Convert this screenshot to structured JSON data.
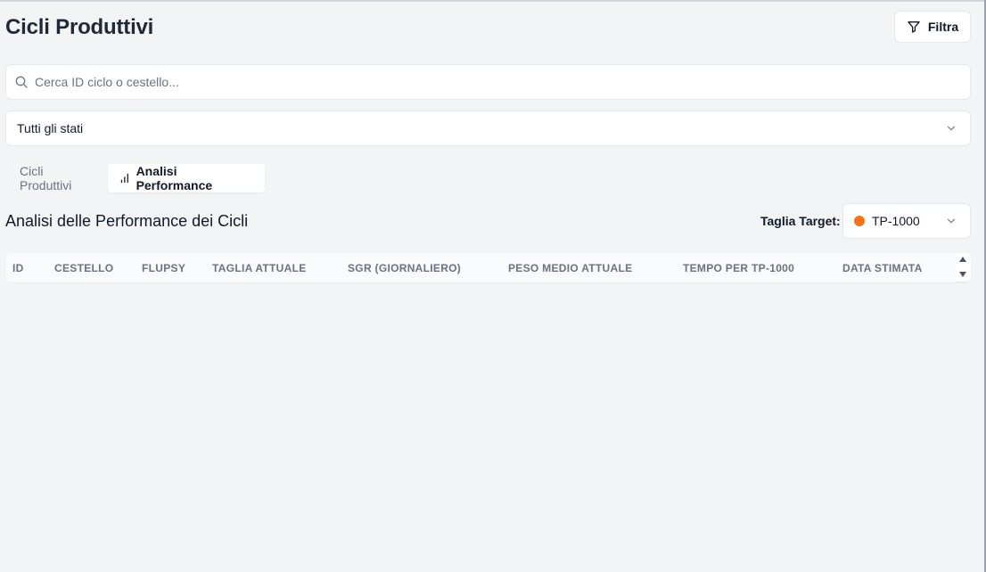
{
  "header": {
    "title": "Cicli Produttivi",
    "filter_label": "Filtra"
  },
  "search": {
    "placeholder": "Cerca ID ciclo o cestello...",
    "value": ""
  },
  "status_filter": {
    "selected": "Tutti gli stati"
  },
  "tabs": [
    {
      "label": "Cicli Produttivi",
      "active": false
    },
    {
      "label": "Analisi Performance",
      "active": true
    }
  ],
  "analysis": {
    "title": "Analisi delle Performance dei Cicli",
    "target_label": "Taglia Target:",
    "target_value": "TP-1000",
    "target_color": "#f97316"
  },
  "table": {
    "columns": [
      "ID",
      "CESTELLO",
      "FLUPSY",
      "TAGLIA ATTUALE",
      "SGR (GIORNALIERO)",
      "PESO MEDIO ATTUALE",
      "TEMPO PER TP-1000",
      "DATA STIMATA"
    ],
    "rows": []
  }
}
